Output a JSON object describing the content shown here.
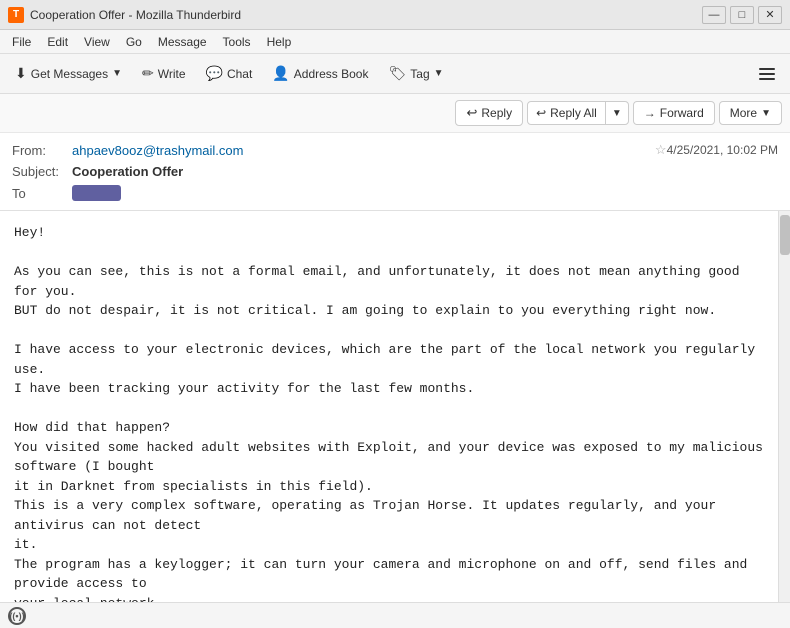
{
  "window": {
    "title": "Cooperation Offer - Mozilla Thunderbird",
    "icon": "🦤"
  },
  "titlebar": {
    "minimize": "—",
    "maximize": "□",
    "close": "✕"
  },
  "menubar": {
    "items": [
      "File",
      "Edit",
      "View",
      "Go",
      "Message",
      "Tools",
      "Help"
    ]
  },
  "toolbar": {
    "get_messages_label": "Get Messages",
    "write_label": "Write",
    "chat_label": "Chat",
    "address_book_label": "Address Book",
    "tag_label": "Tag"
  },
  "reply_toolbar": {
    "reply_label": "Reply",
    "reply_all_label": "Reply All",
    "forward_label": "Forward",
    "more_label": "More"
  },
  "email": {
    "from_label": "From:",
    "from_value": "ahpaev8ooz@trashymail.com",
    "subject_label": "Subject:",
    "subject_value": "Cooperation Offer",
    "to_label": "To",
    "to_value": "",
    "date": "4/25/2021, 10:02 PM",
    "body": "Hey!\n\nAs you can see, this is not a formal email, and unfortunately, it does not mean anything good for you.\nBUT do not despair, it is not critical. I am going to explain to you everything right now.\n\nI have access to your electronic devices, which are the part of the local network you regularly use.\nI have been tracking your activity for the last few months.\n\nHow did that happen?\nYou visited some hacked adult websites with Exploit, and your device was exposed to my malicious software (I bought\nit in Darknet from specialists in this field).\nThis is a very complex software, operating as Trojan Horse. It updates regularly, and your antivirus can not detect\nit.\nThe program has a keylogger; it can turn your camera and microphone on and off, send files and provide access to\nyour local network.\n\nIt took me some time to get access to the information from other devices, and as of now,\nI have all your contacts with conversations, info about your locations, what you like, your favourite websites, etc.\n\nJust recently, I came up with an awesome idea to create the video where you cum in one part of the screen, while the\nvideo was simultaneously playing on another screen. That was fun!\n\nRest assured that I can easily send this video to all your contacts with a couple clicks, and I assume that you\nwould like to prevent this scenario.\n\nWith that in mind, here is my proposal:\nTransfer the amount equivalent to 1650 USD to my Bitcoin wallet, and I will forget about the entire thing. I will\nalso delete all data and videos permanently.\n\nIn my opinion, this is a somewhat modest price for my work.\nIf you don't know how to use Bitcoins, search it in Bing or Google 'how can I purchase Bitcoins' or other stuff like\nthat."
  },
  "statusbar": {
    "icon": "((•))"
  },
  "colors": {
    "accent": "#0060a0",
    "toolbar_bg": "#f5f5f5",
    "border": "#ddd"
  }
}
